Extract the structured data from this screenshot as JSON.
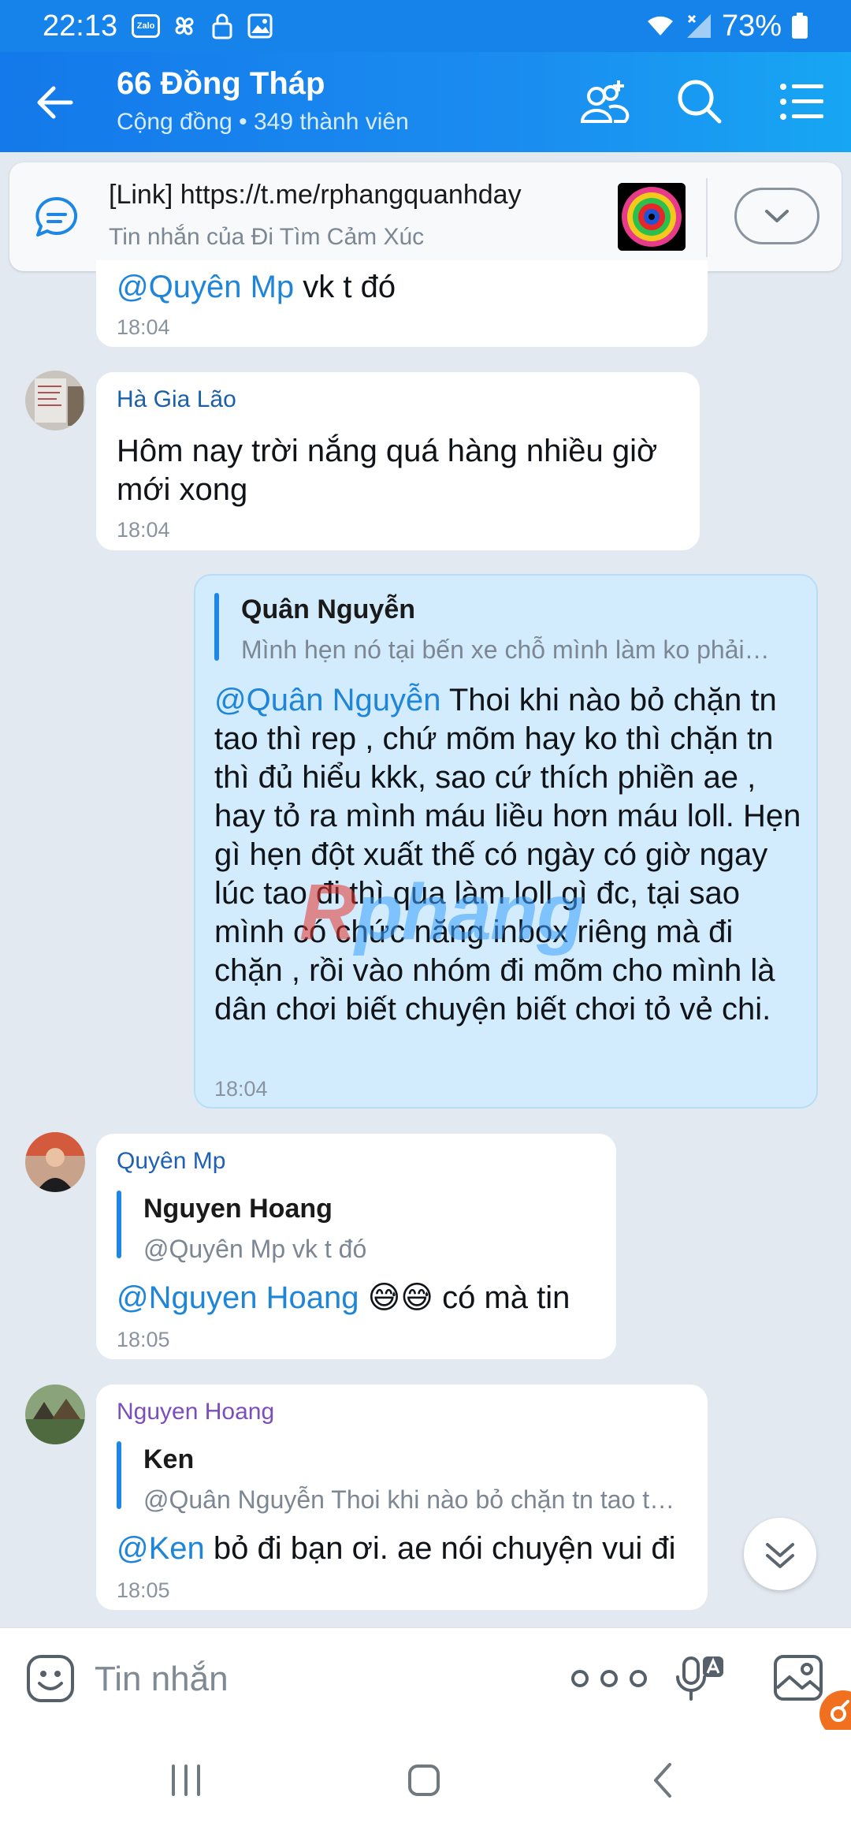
{
  "status_bar": {
    "time": "22:13",
    "battery": "73%",
    "app_badge": "Zalo"
  },
  "header": {
    "title": "66 Đồng Tháp",
    "subtitle": "Cộng đồng • 349 thành viên"
  },
  "pinned": {
    "title": "[Link] https://t.me/rphangquanhday",
    "subtitle": "Tin nhắn của Đi Tìm Cảm Xúc"
  },
  "messages": [
    {
      "mention": "@Quyên Mp",
      "text": " vk t đó",
      "time": "18:04"
    },
    {
      "sender": "Hà Gia Lão",
      "text": "Hôm nay trời nắng quá hàng nhiều giờ mới xong",
      "time": "18:04"
    },
    {
      "quote_name": "Quân Nguyễn",
      "quote_text": "Mình hẹn nó tại bến xe chỗ mình làm ko phải…",
      "mention": "@Quân Nguyễn",
      "text": " Thoi khi nào bỏ chặn tn tao thì rep , chứ mõm hay ko thì chặn tn thì đủ hiểu kkk, sao cứ thích phiền ae , hay tỏ ra mình máu liều hơn máu loll. Hẹn gì hẹn đột xuất thế có ngày có giờ ngay lúc tao đi thì qua làm loll gì đc, tại sao mình có chức năng inbox riêng mà đi chặn , rồi vào nhóm đi mõm cho mình là dân chơi biết chuyện biết chơi tỏ vẻ chi.",
      "time": "18:04"
    },
    {
      "sender": "Quyên Mp",
      "quote_name": "Nguyen Hoang",
      "quote_text": "@Quyên Mp vk t đó",
      "mention": "@Nguyen Hoang",
      "text": " 😅😅 có mà tin",
      "time": "18:05"
    },
    {
      "sender": "Nguyen Hoang",
      "quote_name": "Ken",
      "quote_text": "@Quân Nguyễn Thoi khi nào bỏ chặn tn tao t…",
      "mention": "@Ken",
      "text": " bỏ đi bạn ơi. ae nói chuyện vui đi",
      "time": "18:05"
    }
  ],
  "watermark": {
    "first": "R",
    "rest": "phang"
  },
  "input": {
    "placeholder": "Tin nhắn"
  },
  "colors": {
    "header": "#1683ea",
    "mention": "#1f85d9",
    "my_bubble": "#d3ecfd",
    "background": "#e2e9f1"
  }
}
